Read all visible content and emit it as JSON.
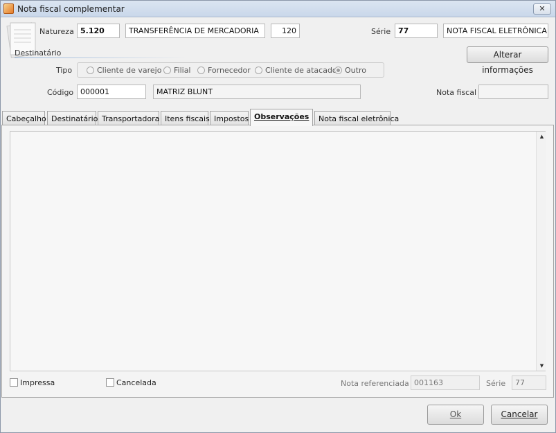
{
  "window": {
    "title": "Nota fiscal complementar",
    "close_label": "⨯⨯"
  },
  "header": {
    "natureza_label": "Natureza",
    "natureza_code": "5.120",
    "natureza_desc": "TRANSFERÊNCIA DE MERCADORIA",
    "natureza_num": "120",
    "serie_label": "Série",
    "serie_value": "77",
    "serie_desc": "NOTA FISCAL ELETRÔNICA"
  },
  "destinatario": {
    "section_title": "Destinatário",
    "alterar_button": "Alterar informações",
    "tipo_label": "Tipo",
    "tipo_options": [
      "Cliente de varejo",
      "Filial",
      "Fornecedor",
      "Cliente de atacado",
      "Outro"
    ],
    "tipo_selected": "Outro",
    "codigo_label": "Código",
    "codigo_value": "000001",
    "nome_value": "MATRIZ BLUNT",
    "nota_fiscal_label": "Nota fiscal",
    "nota_fiscal_value": ""
  },
  "tabs": [
    {
      "label": "Cabeçalho"
    },
    {
      "label": "Destinatário"
    },
    {
      "label": "Transportadora"
    },
    {
      "label": "Itens fiscais"
    },
    {
      "label": "Impostos"
    },
    {
      "label": "Observações"
    },
    {
      "label": "Nota fiscal eletrônica"
    }
  ],
  "active_tab": "Observações",
  "observacoes": {
    "text": "",
    "impressa_label": "Impressa",
    "impressa_checked": false,
    "cancelada_label": "Cancelada",
    "cancelada_checked": false,
    "nota_ref_label": "Nota referenciada",
    "nota_ref_value": "001163",
    "serie_label": "Série",
    "serie_value": "77"
  },
  "footer": {
    "ok_label": "Ok",
    "cancel_label": "Cancelar"
  }
}
